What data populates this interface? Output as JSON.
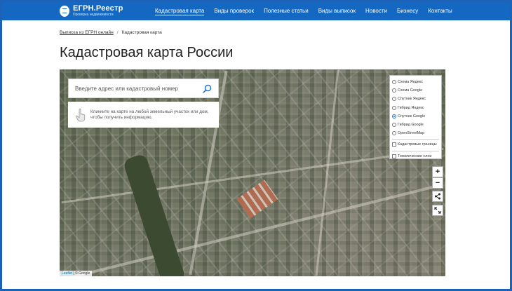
{
  "header": {
    "logo_title": "ЕГРН.Реестр",
    "logo_subtitle": "Проверка недвижимости",
    "nav": [
      {
        "label": "Кадастровая карта",
        "active": true
      },
      {
        "label": "Виды проверок"
      },
      {
        "label": "Полезные статьи"
      },
      {
        "label": "Виды выписок"
      },
      {
        "label": "Новости"
      },
      {
        "label": "Бизнесу"
      },
      {
        "label": "Контакты"
      }
    ]
  },
  "breadcrumb": {
    "link": "Выписка из ЕГРН онлайн",
    "separator": "/",
    "current": "Кадастровая карта"
  },
  "page_title": "Кадастровая карта России",
  "map": {
    "search_placeholder": "Введите адрес или кадастровый номер",
    "hint": "Кликните на карте на любой земельный участок или дом, чтобы получить информацию.",
    "layers": {
      "base": [
        {
          "label": "Схема Яндекс",
          "selected": false
        },
        {
          "label": "Схема Google",
          "selected": false
        },
        {
          "label": "Спутник Яндекс",
          "selected": false
        },
        {
          "label": "Гибрид Яндекс",
          "selected": false
        },
        {
          "label": "Спутник Google",
          "selected": true
        },
        {
          "label": "Гибрид Google",
          "selected": false
        },
        {
          "label": "OpenStreetMap",
          "selected": false
        }
      ],
      "overlays": [
        {
          "label": "Кадастровые границы",
          "checked": false
        },
        {
          "label": "Тематические слои",
          "checked": false
        }
      ]
    },
    "controls": {
      "zoom_in": "+",
      "zoom_out": "−"
    },
    "attribution": {
      "leaflet": "Leaflet",
      "rest": "| © Google"
    }
  },
  "colors": {
    "header_bg": "#1468c2",
    "page_border": "#1c62b9",
    "accent": "#1a6fd6"
  }
}
